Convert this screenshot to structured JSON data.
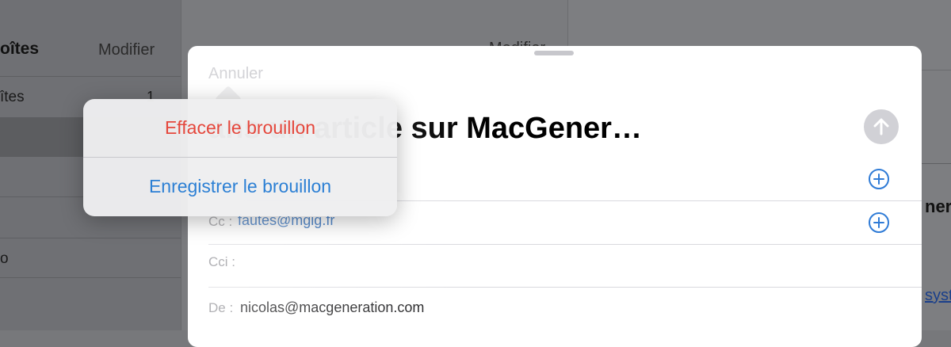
{
  "background": {
    "mailboxes": {
      "title": "oîtes",
      "edit_label": "Modifier",
      "rows": [
        {
          "label": "îtes",
          "count": "1"
        },
        {
          "label": "",
          "count": ""
        },
        {
          "label": "",
          "count": ""
        },
        {
          "label": "",
          "count": ""
        },
        {
          "label": "o",
          "count": ""
        }
      ]
    },
    "message_list": {
      "edit_label": "Modifier"
    },
    "reader": {
      "peek_heading": "nera",
      "peek_link": "syste"
    }
  },
  "compose": {
    "cancel_label": "Annuler",
    "subject": "ans un article sur MacGener…",
    "cc_label": "Cc :",
    "cc_value": "fautes@mgig.fr",
    "bcc_label": "Cci :",
    "from_label": "De :",
    "from_value": "nicolas@macgeneration.com"
  },
  "popover": {
    "delete_label": "Effacer le brouillon",
    "save_label": "Enregistrer le brouillon"
  },
  "colors": {
    "destructive": "#e5473c",
    "accent": "#2b7fd4"
  },
  "icons": [
    "send-arrow-up-icon",
    "add-contact-icon"
  ]
}
